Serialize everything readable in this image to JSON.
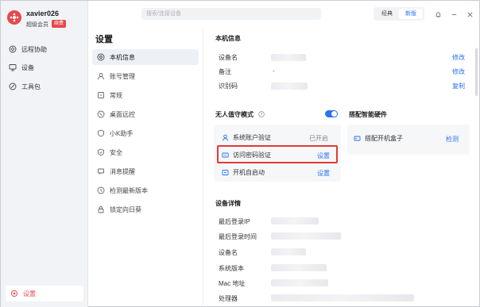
{
  "user": {
    "name": "xavier026",
    "member": "超级会员",
    "badge": "续费"
  },
  "sidebar": {
    "items": [
      {
        "label": "远程协助",
        "icon": "remote-assist-icon"
      },
      {
        "label": "设备",
        "icon": "monitor-icon"
      },
      {
        "label": "工具包",
        "icon": "toolbox-icon"
      }
    ],
    "settings_label": "设置"
  },
  "topbar": {
    "search_placeholder": "搜索/连接设备",
    "mode_classic": "经典",
    "mode_new": "新版"
  },
  "menu": {
    "title": "设置",
    "items": [
      {
        "label": "本机信息",
        "icon": "device-info-icon"
      },
      {
        "label": "账号管理",
        "icon": "account-icon"
      },
      {
        "label": "常规",
        "icon": "general-icon"
      },
      {
        "label": "桌面远控",
        "icon": "desktop-control-icon"
      },
      {
        "label": "小K助手",
        "icon": "assistant-icon"
      },
      {
        "label": "安全",
        "icon": "shield-icon"
      },
      {
        "label": "消息提醒",
        "icon": "message-icon"
      },
      {
        "label": "检测最新版本",
        "icon": "update-icon"
      },
      {
        "label": "锁定向日葵",
        "icon": "lock-icon"
      }
    ]
  },
  "local_info": {
    "title": "本机信息",
    "device_name_label": "设备名",
    "note_label": "备注",
    "note_value": "-",
    "id_label": "识别码",
    "edit1": "修改",
    "edit2": "修改",
    "copy": "复制"
  },
  "unattended": {
    "title": "无人值守模式",
    "enabled": true,
    "items": [
      {
        "label": "系统账户验证",
        "status": "已开启",
        "icon": "user-icon"
      },
      {
        "label": "访问密码验证",
        "action": "设置",
        "icon": "password-icon"
      },
      {
        "label": "开机自启动",
        "action": "设置",
        "icon": "power-icon"
      }
    ]
  },
  "hardware": {
    "title": "搭配智能硬件",
    "item": "搭配开机盒子",
    "action": "检测"
  },
  "device_details": {
    "title": "设备详情",
    "labels": [
      "最后登录IP",
      "最后登录时间",
      "设备名",
      "系统版本",
      "Mac 地址",
      "处理器"
    ]
  }
}
